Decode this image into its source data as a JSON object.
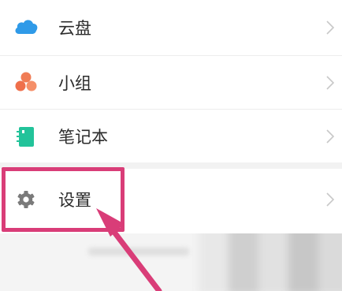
{
  "menu": {
    "items": [
      {
        "label": "云盘",
        "icon": "cloud-icon",
        "color": "#2f9ae8"
      },
      {
        "label": "小组",
        "icon": "group-icon",
        "color": "#f07c55"
      },
      {
        "label": "笔记本",
        "icon": "notebook-icon",
        "color": "#22c39a"
      },
      {
        "label": "设置",
        "icon": "gear-icon",
        "color": "#7a7a7a"
      }
    ]
  },
  "annotation": {
    "highlight_color": "#d93d78",
    "target": "设置"
  }
}
